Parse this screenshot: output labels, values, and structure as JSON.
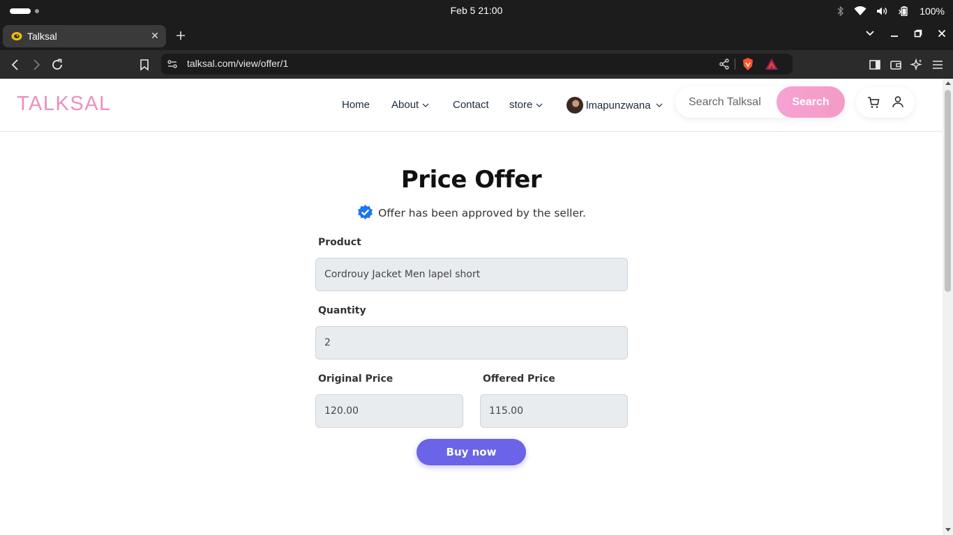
{
  "os": {
    "clock": "Feb 5  21:00",
    "battery": "100%"
  },
  "browser": {
    "tab_title": "Talksal",
    "url": "talksal.com/view/offer/1"
  },
  "site": {
    "logo": "TALKSAL",
    "brand_color": "#f08dbf",
    "nav": {
      "home": "Home",
      "about": "About",
      "contact": "Contact",
      "store": "store",
      "user": "lmapunzwana"
    },
    "search": {
      "placeholder": "Search Talksal",
      "button": "Search"
    }
  },
  "offer": {
    "title": "Price Offer",
    "status": "Offer has been approved by the seller.",
    "status_color": "#1877f2",
    "product_label": "Product",
    "product_value": "Cordrouy Jacket Men lapel short",
    "quantity_label": "Quantity",
    "quantity_value": "2",
    "original_price_label": "Original Price",
    "original_price_value": "120.00",
    "offered_price_label": "Offered Price",
    "offered_price_value": "115.00",
    "buy_button": "Buy now",
    "buy_color": "#6b63e8"
  }
}
